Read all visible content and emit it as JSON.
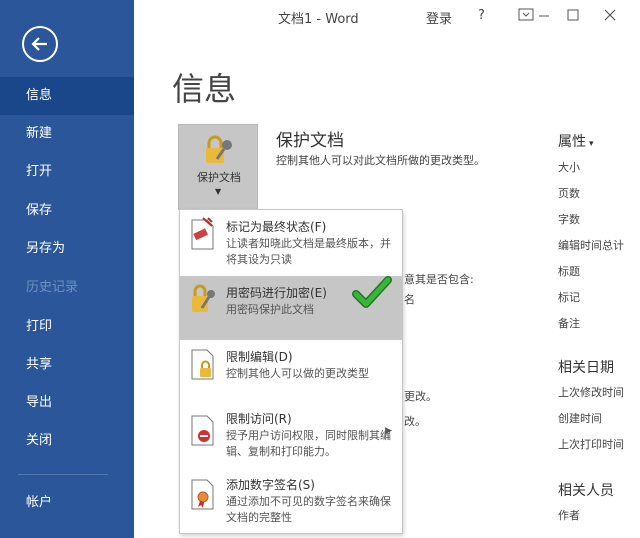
{
  "window": {
    "title": "文档1 - Word",
    "login": "登录",
    "help": "?"
  },
  "sidebar": {
    "items": [
      {
        "label": "信息"
      },
      {
        "label": "新建"
      },
      {
        "label": "打开"
      },
      {
        "label": "保存"
      },
      {
        "label": "另存为"
      },
      {
        "label": "历史记录"
      },
      {
        "label": "打印"
      },
      {
        "label": "共享"
      },
      {
        "label": "导出"
      },
      {
        "label": "关闭"
      },
      {
        "label": "帐户"
      }
    ]
  },
  "main": {
    "title": "信息",
    "protect": {
      "tile_label": "保护文档",
      "heading": "保护文档",
      "description": "控制其他人可以对此文档所做的更改类型。"
    },
    "background_fragments": [
      "意其是否包含:",
      "名",
      "更改。",
      "改。"
    ]
  },
  "properties": {
    "heading": "属性",
    "items": [
      "大小",
      "页数",
      "字数",
      "编辑时间总计",
      "标题",
      "标记",
      "备注"
    ],
    "dates_heading": "相关日期",
    "dates": [
      "上次修改时间",
      "创建时间",
      "上次打印时间"
    ],
    "people_heading": "相关人员",
    "people": [
      "作者"
    ]
  },
  "dropdown": {
    "items": [
      {
        "title": "标记为最终状态(F)",
        "desc": "让读者知晓此文档是最终版本，并将其设为只读"
      },
      {
        "title": "用密码进行加密(E)",
        "desc": "用密码保护此文档"
      },
      {
        "title": "限制编辑(D)",
        "desc": "控制其他人可以做的更改类型"
      },
      {
        "title": "限制访问(R)",
        "desc": "授予用户访问权限，同时限制其编辑、复制和打印能力。"
      },
      {
        "title": "添加数字签名(S)",
        "desc": "通过添加不可见的数字签名来确保文档的完整性"
      }
    ]
  },
  "colors": {
    "sidebar": "#2b579a",
    "sidebar_active": "#19478a",
    "highlight": "#c6c6c6",
    "check": "#2e9a2e"
  }
}
